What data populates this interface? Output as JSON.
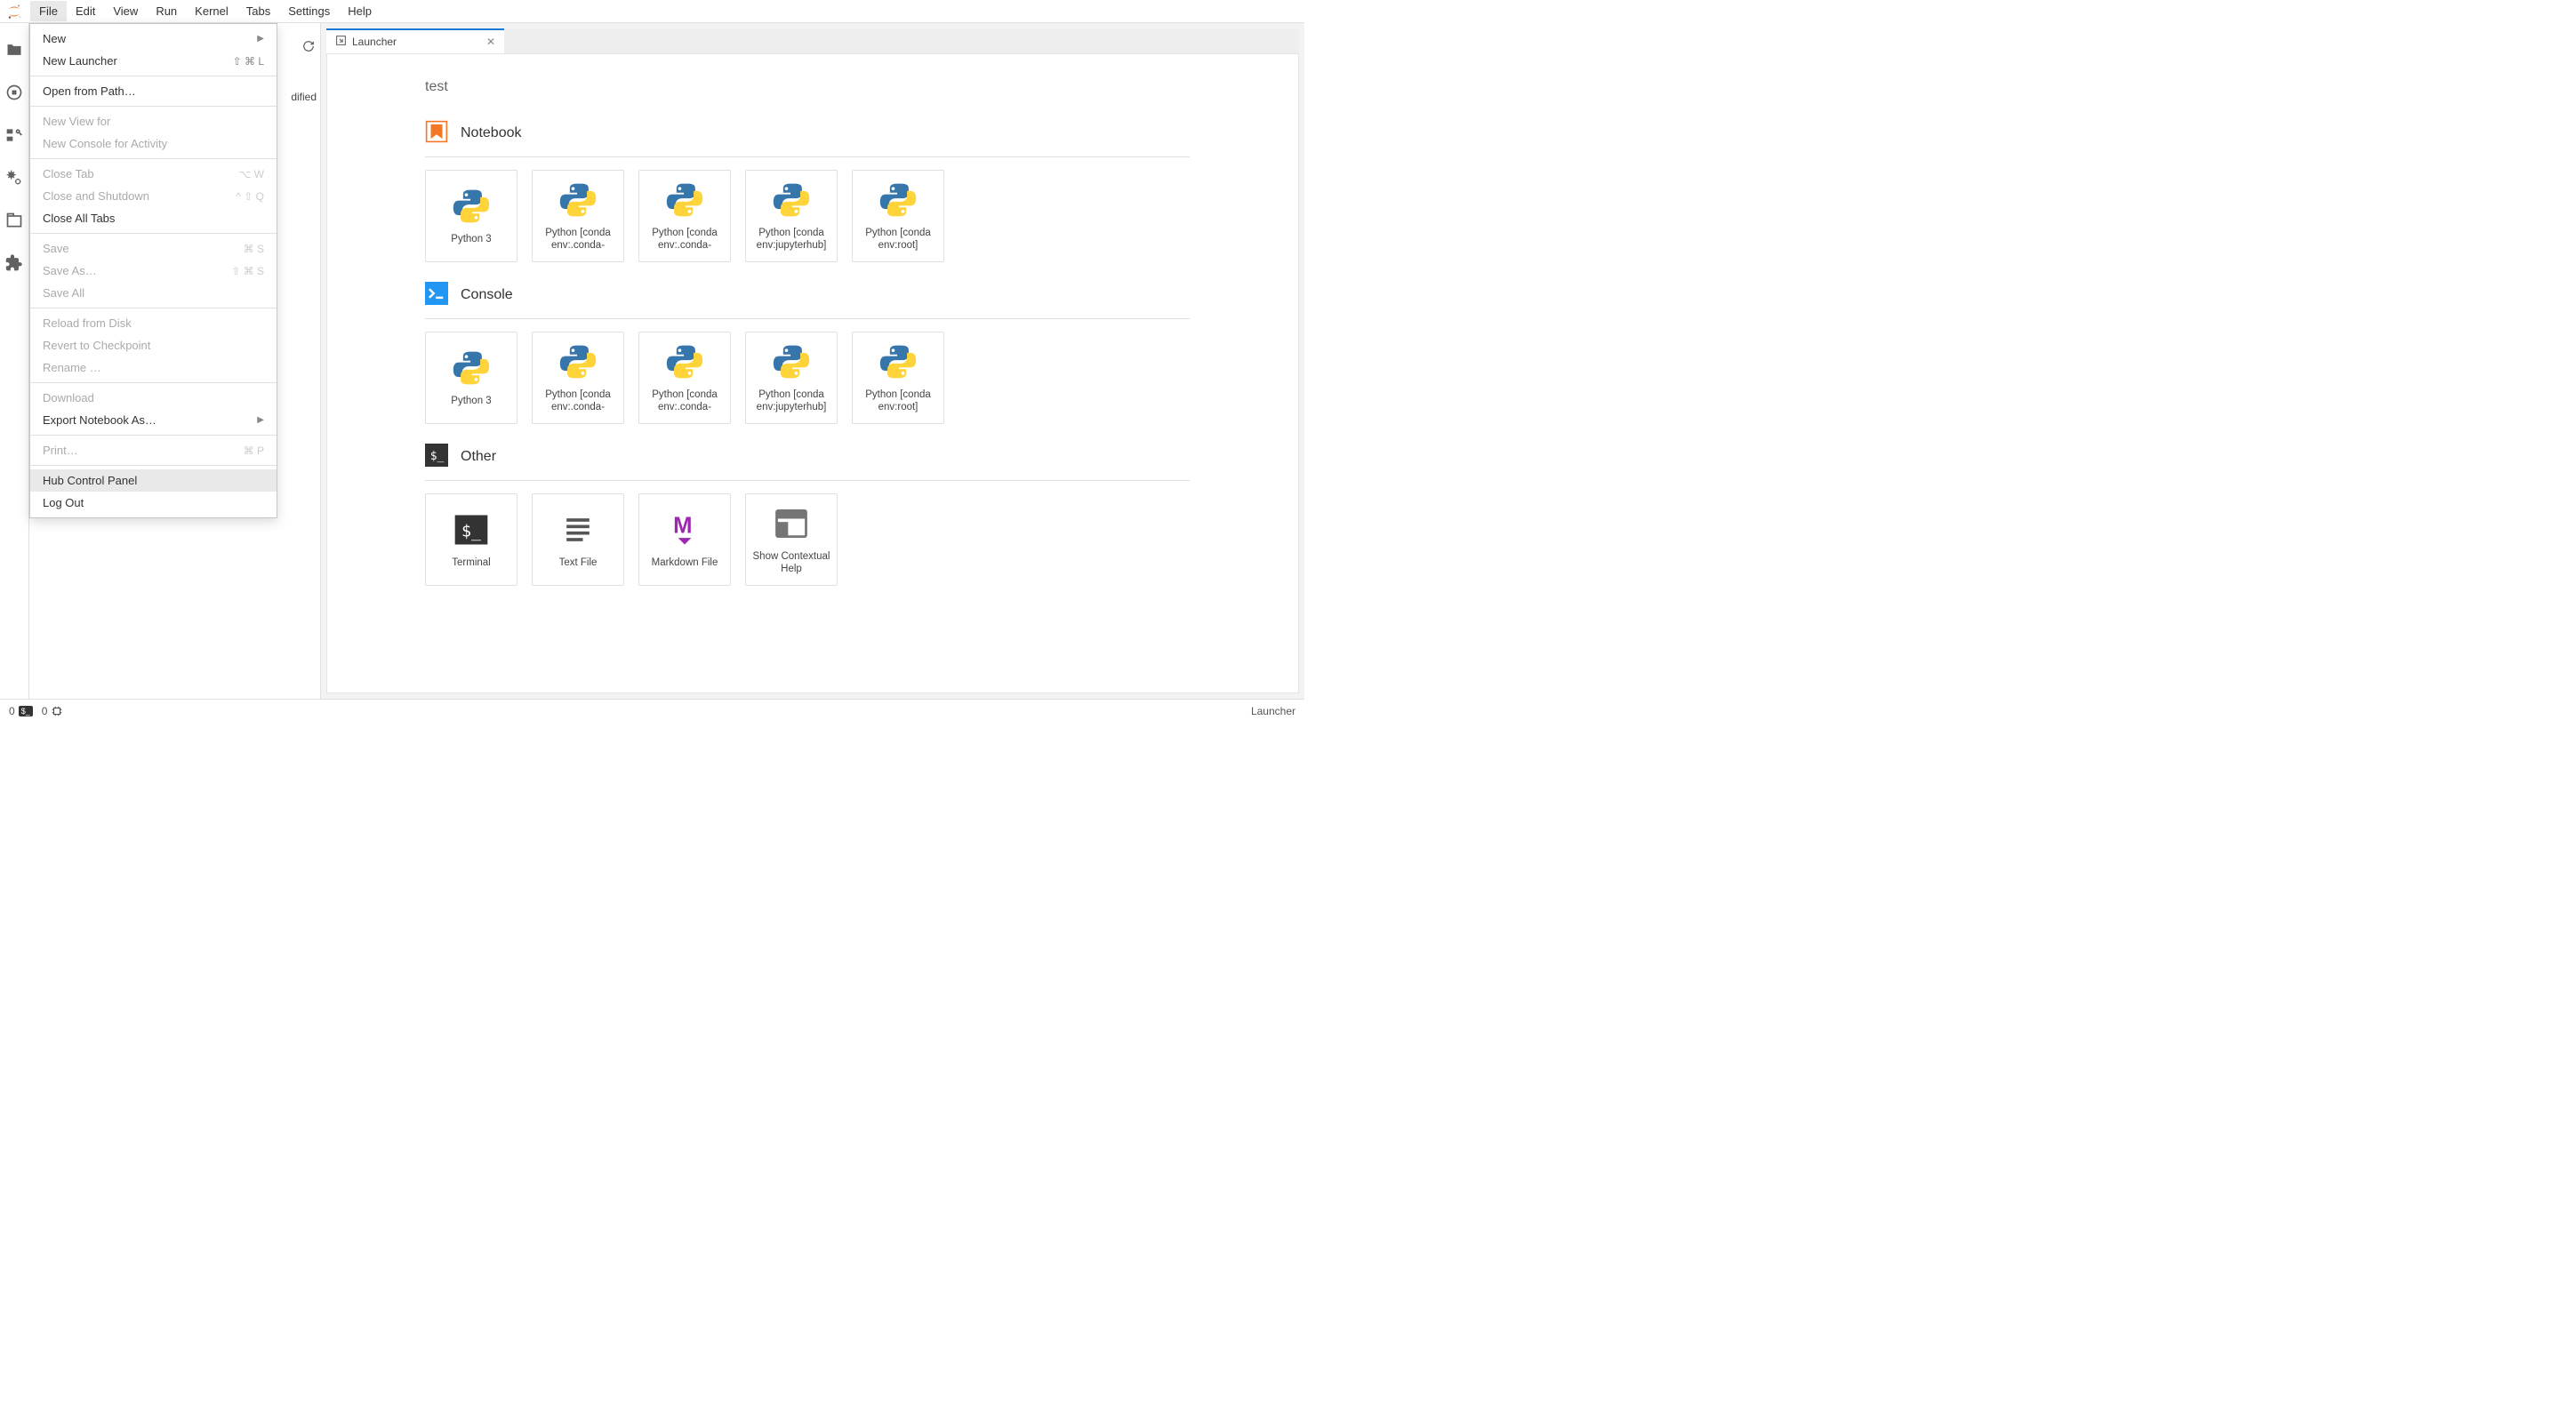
{
  "menubar": {
    "items": [
      "File",
      "Edit",
      "View",
      "Run",
      "Kernel",
      "Tabs",
      "Settings",
      "Help"
    ],
    "open_index": 0
  },
  "file_menu": {
    "items": [
      {
        "label": "New",
        "enabled": true,
        "submenu": true
      },
      {
        "label": "New Launcher",
        "enabled": true,
        "shortcut": "⇧ ⌘ L"
      },
      {
        "sep": true
      },
      {
        "label": "Open from Path…",
        "enabled": true
      },
      {
        "sep": true
      },
      {
        "label": "New View for",
        "enabled": false
      },
      {
        "label": "New Console for Activity",
        "enabled": false
      },
      {
        "sep": true
      },
      {
        "label": "Close Tab",
        "enabled": false,
        "shortcut": "⌥ W"
      },
      {
        "label": "Close and Shutdown",
        "enabled": false,
        "shortcut": "^ ⇧ Q"
      },
      {
        "label": "Close All Tabs",
        "enabled": true
      },
      {
        "sep": true
      },
      {
        "label": "Save",
        "enabled": false,
        "shortcut": "⌘ S"
      },
      {
        "label": "Save As…",
        "enabled": false,
        "shortcut": "⇧ ⌘ S"
      },
      {
        "label": "Save All",
        "enabled": false
      },
      {
        "sep": true
      },
      {
        "label": "Reload from Disk",
        "enabled": false
      },
      {
        "label": "Revert to Checkpoint",
        "enabled": false
      },
      {
        "label": "Rename …",
        "enabled": false
      },
      {
        "sep": true
      },
      {
        "label": "Download",
        "enabled": false
      },
      {
        "label": "Export Notebook As…",
        "enabled": true,
        "submenu": true
      },
      {
        "sep": true
      },
      {
        "label": "Print…",
        "enabled": false,
        "shortcut": "⌘ P"
      },
      {
        "sep": true
      },
      {
        "label": "Hub Control Panel",
        "enabled": true,
        "hover": true
      },
      {
        "label": "Log Out",
        "enabled": true
      }
    ]
  },
  "file_browser": {
    "partial_column": "dified"
  },
  "tab": {
    "title": "Launcher"
  },
  "launcher": {
    "cwd": "test",
    "sections": [
      {
        "title": "Notebook",
        "icon": "notebook",
        "cards": [
          {
            "label": "Python 3",
            "icon": "python"
          },
          {
            "label": "Python [conda env:.conda-",
            "icon": "python"
          },
          {
            "label": "Python [conda env:.conda-",
            "icon": "python"
          },
          {
            "label": "Python [conda env:jupyterhub]",
            "icon": "python"
          },
          {
            "label": "Python [conda env:root]",
            "icon": "python"
          }
        ]
      },
      {
        "title": "Console",
        "icon": "console",
        "cards": [
          {
            "label": "Python 3",
            "icon": "python"
          },
          {
            "label": "Python [conda env:.conda-",
            "icon": "python"
          },
          {
            "label": "Python [conda env:.conda-",
            "icon": "python"
          },
          {
            "label": "Python [conda env:jupyterhub]",
            "icon": "python"
          },
          {
            "label": "Python [conda env:root]",
            "icon": "python"
          }
        ]
      },
      {
        "title": "Other",
        "icon": "terminal",
        "cards": [
          {
            "label": "Terminal",
            "icon": "terminal-lg"
          },
          {
            "label": "Text File",
            "icon": "textfile"
          },
          {
            "label": "Markdown File",
            "icon": "markdown"
          },
          {
            "label": "Show Contextual Help",
            "icon": "help"
          }
        ]
      }
    ]
  },
  "statusbar": {
    "terminals": "0",
    "kernels_running": "0",
    "mode": "Launcher"
  }
}
